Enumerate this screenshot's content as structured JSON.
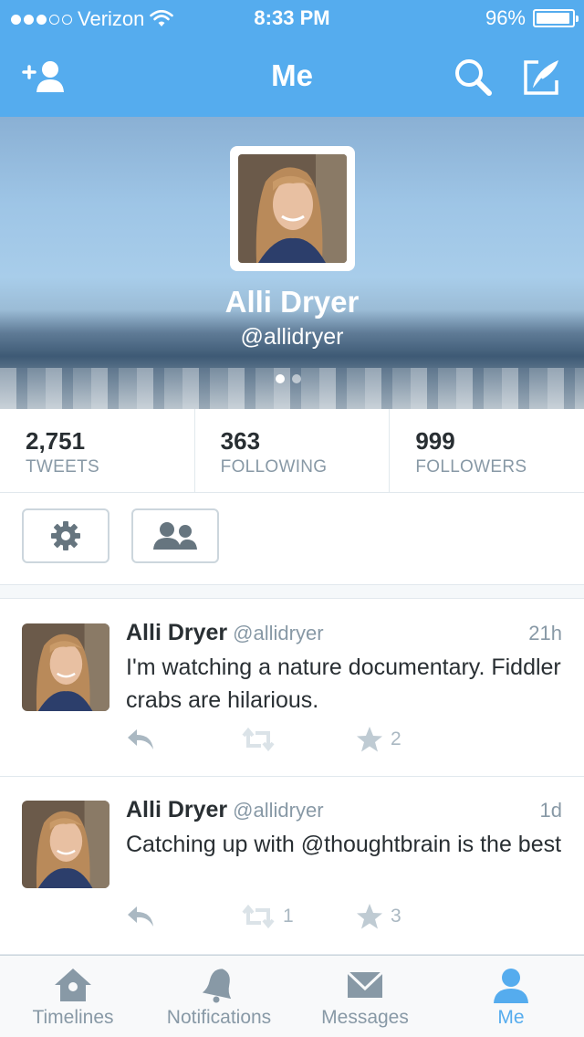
{
  "status_bar": {
    "carrier": "Verizon",
    "time": "8:33 PM",
    "battery": "96%",
    "battery_level": 0.96
  },
  "nav": {
    "title": "Me",
    "icons": {
      "left": "add-user-icon",
      "search": "search-icon",
      "compose": "compose-icon"
    }
  },
  "profile": {
    "name": "Alli Dryer",
    "handle": "@allidryer",
    "pager": {
      "pages": 2,
      "current": 1
    }
  },
  "stats": [
    {
      "value": "2,751",
      "label": "TWEETS"
    },
    {
      "value": "363",
      "label": "FOLLOWING"
    },
    {
      "value": "999",
      "label": "FOLLOWERS"
    }
  ],
  "action_buttons": {
    "settings_icon": "gear-icon",
    "accounts_icon": "people-icon"
  },
  "tweets": [
    {
      "name": "Alli Dryer",
      "handle": "@allidryer",
      "time": "21h",
      "text": "I'm watching a nature documentary. Fiddler crabs are hilarious.",
      "retweets": "",
      "favorites": "2"
    },
    {
      "name": "Alli Dryer",
      "handle": "@allidryer",
      "time": "1d",
      "text": "Catching up with @thoughtbrain is the best",
      "retweets": "1",
      "favorites": "3"
    }
  ],
  "tabs": [
    {
      "label": "Timelines",
      "icon": "home-icon"
    },
    {
      "label": "Notifications",
      "icon": "bell-icon"
    },
    {
      "label": "Messages",
      "icon": "envelope-icon"
    },
    {
      "label": "Me",
      "icon": "person-icon",
      "active": true
    }
  ],
  "colors": {
    "brand": "#55acee",
    "text": "#292f33",
    "muted": "#8899a6",
    "icon_muted": "#aab8c2"
  }
}
